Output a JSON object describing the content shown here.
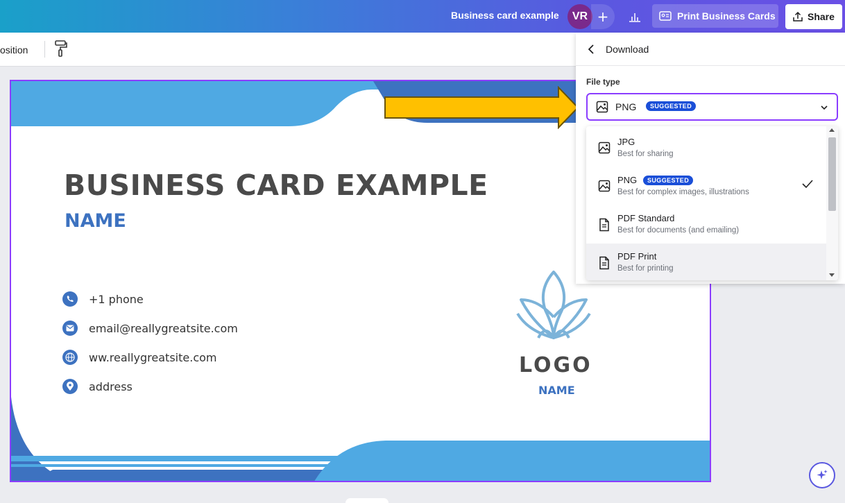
{
  "topbar": {
    "doc_title": "Business card example",
    "avatar_initials": "VR",
    "add_label": "+",
    "print_label": "Print Business Cards",
    "share_label": "Share"
  },
  "toolbar": {
    "position_label": "osition"
  },
  "card": {
    "title": "BUSINESS CARD EXAMPLE",
    "name": "NAME",
    "contacts": [
      {
        "icon": "phone-icon",
        "text": "+1 phone"
      },
      {
        "icon": "email-icon",
        "text": "email@reallygreatsite.com"
      },
      {
        "icon": "globe-icon",
        "text": "ww.reallygreatsite.com"
      },
      {
        "icon": "location-icon",
        "text": "address"
      }
    ],
    "logo_text": "LOGO",
    "logo_name": "NAME",
    "colors": {
      "accent": "#3d72c0",
      "light_blue": "#4fa9e3",
      "title": "#4a4a4a"
    }
  },
  "download_panel": {
    "title": "Download",
    "file_type_label": "File type",
    "selected": {
      "name": "PNG",
      "badge": "SUGGESTED"
    },
    "options": [
      {
        "name": "JPG",
        "desc": "Best for sharing",
        "icon": "image-icon",
        "badge": "",
        "checked": false
      },
      {
        "name": "PNG",
        "desc": "Best for complex images, illustrations",
        "icon": "image-icon",
        "badge": "SUGGESTED",
        "checked": true
      },
      {
        "name": "PDF Standard",
        "desc": "Best for documents (and emailing)",
        "icon": "document-icon",
        "badge": "",
        "checked": false
      },
      {
        "name": "PDF Print",
        "desc": "Best for printing",
        "icon": "document-icon",
        "badge": "",
        "checked": false
      }
    ]
  }
}
